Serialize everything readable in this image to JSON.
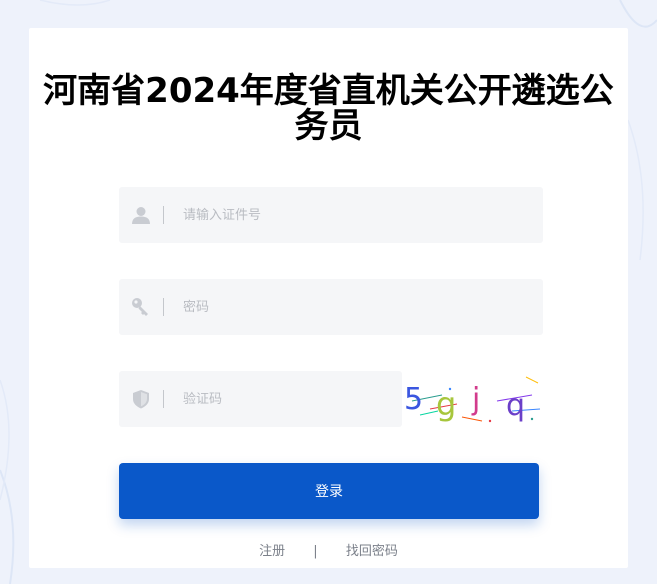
{
  "page": {
    "title": "河南省2024年度省直机关公开遴选公务员"
  },
  "form": {
    "id_number": {
      "placeholder": "请输入证件号",
      "value": "",
      "icon": "user-icon"
    },
    "password": {
      "placeholder": "密码",
      "value": "",
      "icon": "key-icon"
    },
    "captcha": {
      "placeholder": "验证码",
      "value": "",
      "icon": "shield-icon",
      "image_text": "5gjq"
    },
    "login_label": "登录"
  },
  "links": {
    "register": "注册",
    "separator": "|",
    "recover_password": "找回密码"
  },
  "colors": {
    "background": "#eef2fb",
    "card": "#ffffff",
    "field_bg": "#f5f6f8",
    "primary_button": "#0a58c9",
    "link_text": "#7b808a"
  }
}
